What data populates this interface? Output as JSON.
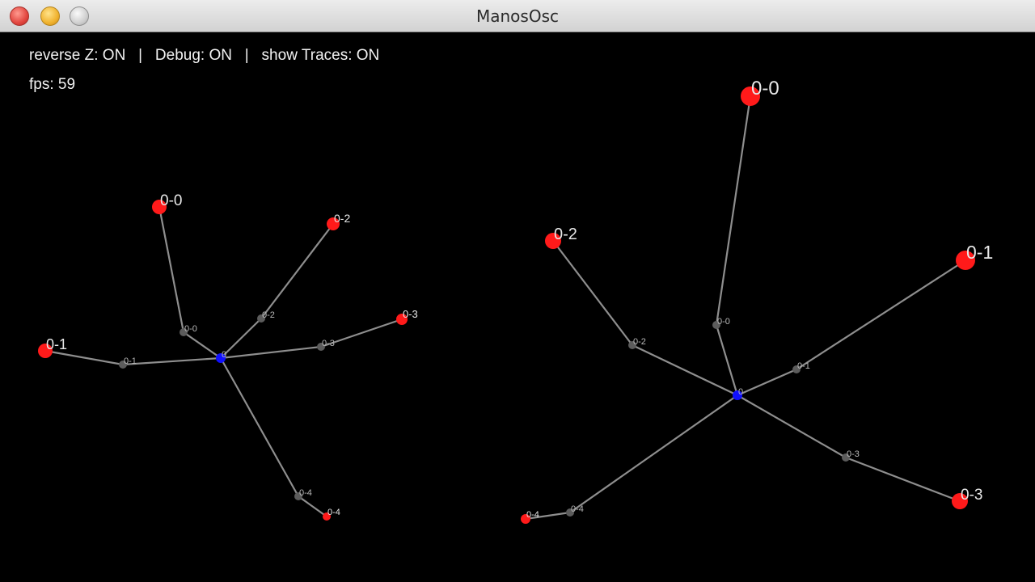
{
  "window": {
    "title": "ManosOsc"
  },
  "status": {
    "line1": "reverse Z: ON   |   Debug: ON   |   show Traces: ON",
    "line2": "fps: 59"
  },
  "hands": [
    {
      "root_label": "0",
      "joints": [
        {
          "joint_label": "0-0",
          "tip_label": "0-0"
        },
        {
          "joint_label": "0-1",
          "tip_label": "0-1"
        },
        {
          "joint_label": "0-2",
          "tip_label": "0-2"
        },
        {
          "joint_label": "0-3",
          "tip_label": "0-3"
        },
        {
          "joint_label": "0-4",
          "tip_label": "0-4"
        }
      ]
    },
    {
      "root_label": "0",
      "joints": [
        {
          "joint_label": "0-0",
          "tip_label": "0-0"
        },
        {
          "joint_label": "0-1",
          "tip_label": "0-1"
        },
        {
          "joint_label": "0-2",
          "tip_label": "0-2"
        },
        {
          "joint_label": "0-3",
          "tip_label": "0-3"
        },
        {
          "joint_label": "0-4",
          "tip_label": "0-4"
        }
      ]
    }
  ],
  "colors": {
    "background": "#000000",
    "edge": "#8e8e8e",
    "tip": "#ff1a1a",
    "joint": "#5c5c5c",
    "root": "#1010ff"
  }
}
